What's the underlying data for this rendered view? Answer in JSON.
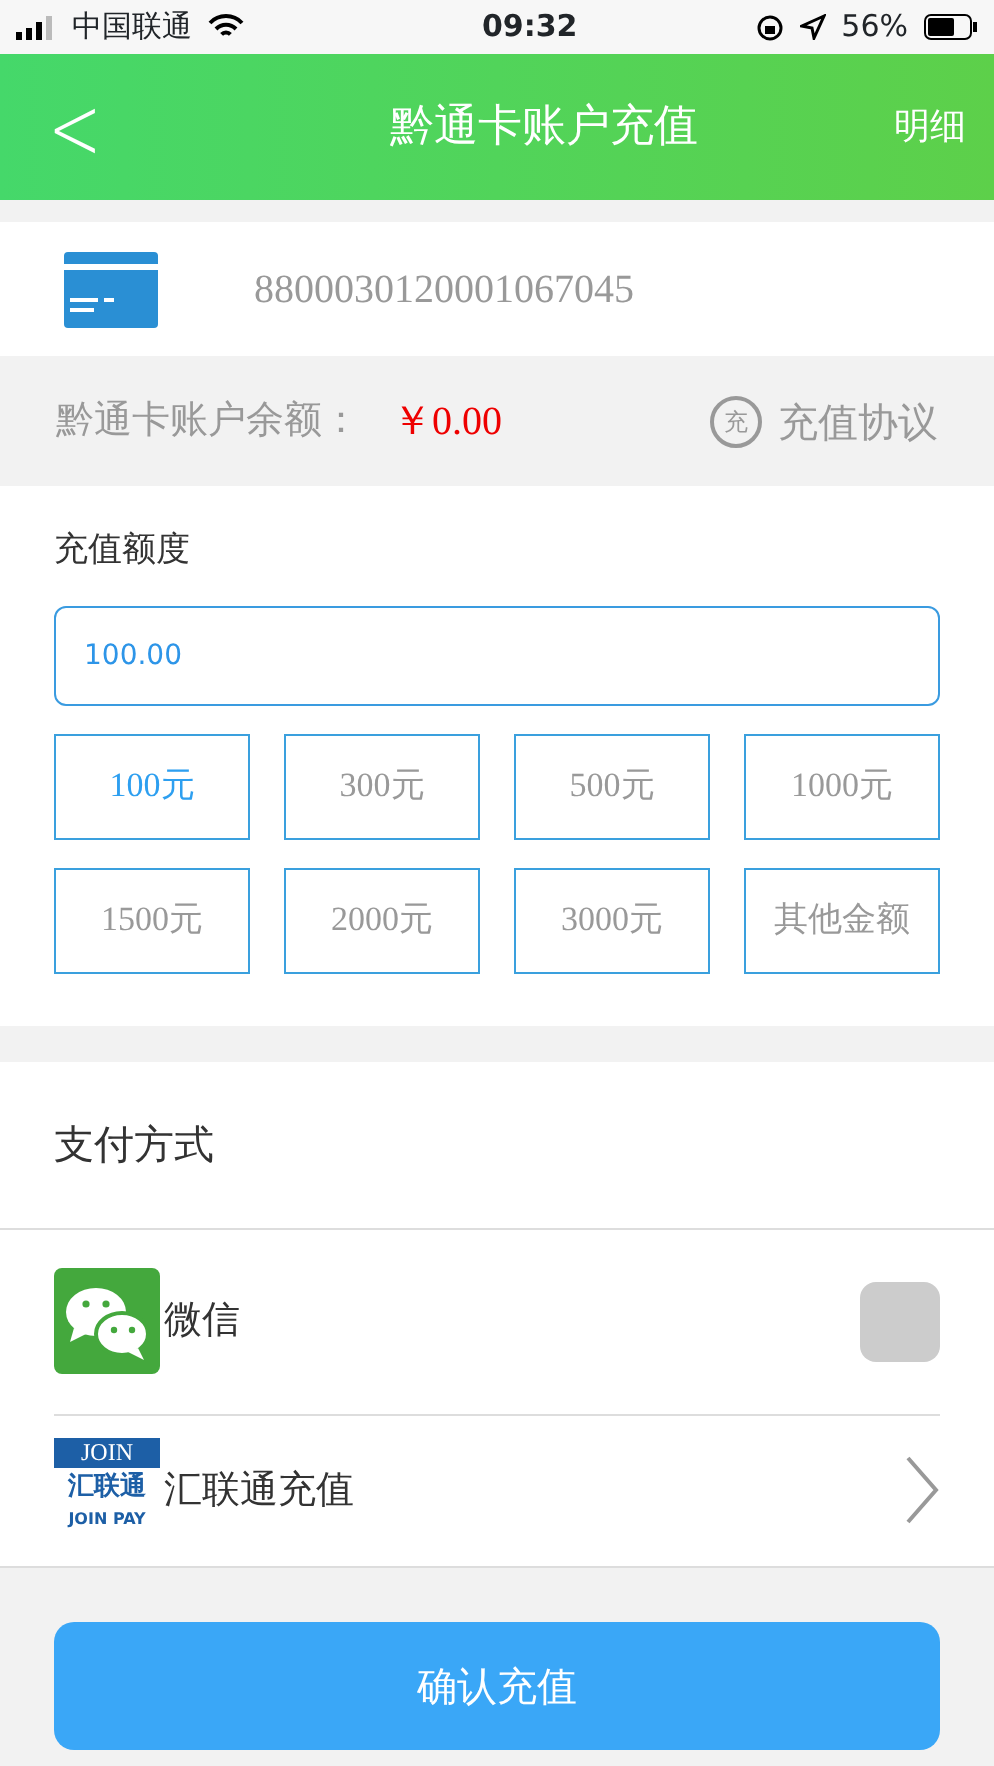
{
  "status_bar": {
    "carrier": "中国联通",
    "time": "09:32",
    "battery": "56%"
  },
  "header": {
    "back": "<",
    "title": "黔通卡账户充值",
    "action": "明细"
  },
  "card": {
    "number": "8800030120001067045"
  },
  "balance": {
    "label": "黔通卡账户余额：",
    "amount": "￥0.00",
    "agreement_badge": "充",
    "agreement": "充值协议"
  },
  "amount_section": {
    "title": "充值额度",
    "input_value": "100.00",
    "options": [
      {
        "label": "100元",
        "selected": true
      },
      {
        "label": "300元",
        "selected": false
      },
      {
        "label": "500元",
        "selected": false
      },
      {
        "label": "1000元",
        "selected": false
      },
      {
        "label": "1500元",
        "selected": false
      },
      {
        "label": "2000元",
        "selected": false
      },
      {
        "label": "3000元",
        "selected": false
      },
      {
        "label": "其他金额",
        "selected": false
      }
    ]
  },
  "payment": {
    "title": "支付方式",
    "methods": [
      {
        "kind": "checkbox",
        "name": "微信",
        "checked": false
      },
      {
        "kind": "link",
        "name": "汇联通充值",
        "logo_texts": [
          "JOIN",
          "汇联通",
          "JOIN PAY"
        ]
      }
    ]
  },
  "confirm_button": "确认充值"
}
